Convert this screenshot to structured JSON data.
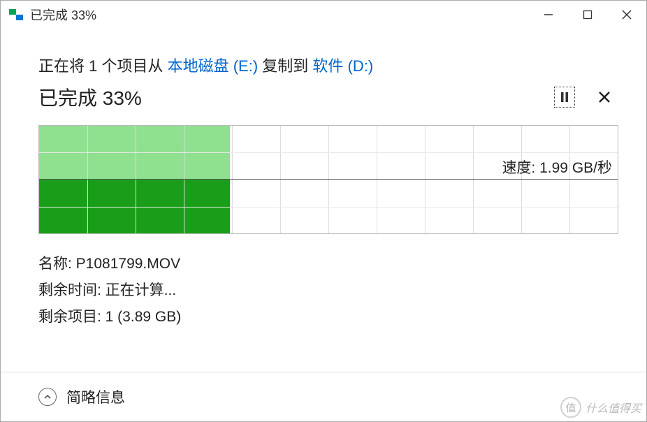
{
  "titlebar": {
    "title": "已完成 33%"
  },
  "copy": {
    "prefix": "正在将 ",
    "item_count": "1",
    "middle": " 个项目从 ",
    "source": "本地磁盘 (E:)",
    "verb": " 复制到 ",
    "dest": "软件 (D:)"
  },
  "status": {
    "text": "已完成 33%"
  },
  "chart_data": {
    "type": "area",
    "progress_percent": 33,
    "speed_label": "速度: 1.99 GB/秒",
    "grid": {
      "cols": 12,
      "rows_per_half": 2
    },
    "top_fill_color": "#8fe08f",
    "bottom_fill_color": "#1a9e1a"
  },
  "details": {
    "name_label": "名称: ",
    "name_value": "P1081799.MOV",
    "time_label": "剩余时间: ",
    "time_value": "正在计算...",
    "items_label": "剩余项目: ",
    "items_value": "1 (3.89 GB)"
  },
  "footer": {
    "brief": "简略信息"
  },
  "watermark": {
    "char": "值",
    "text": "什么值得买"
  }
}
